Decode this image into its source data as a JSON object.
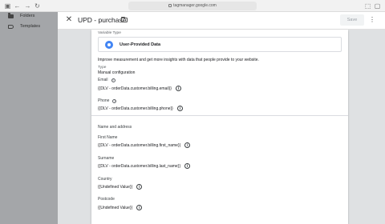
{
  "browser": {
    "url": "tagmanager.google.com"
  },
  "sidebar": {
    "items": [
      {
        "label": "Folders",
        "icon": "folder-icon"
      },
      {
        "label": "Templates",
        "icon": "tag-icon"
      }
    ]
  },
  "panel": {
    "title": "UPD - purchase",
    "save_label": "Save"
  },
  "variable": {
    "type_label": "Variable Type",
    "type_name": "User-Provided Data",
    "description": "Improve measurement and get more insights with data that people provide to your website.",
    "type_heading": "Type",
    "type_value": "Manual configuration",
    "fields": [
      {
        "label": "Email",
        "value": "{{DLV - orderData.customer.billing.email}}"
      },
      {
        "label": "Phone",
        "value": "{{DLV - orderData.customer.billing.phone}}"
      }
    ],
    "address_heading": "Name and address",
    "address_fields": [
      {
        "label": "First Name",
        "value": "{{DLV - orderData.customer.billing.first_name}}"
      },
      {
        "label": "Surname",
        "value": "{{DLV - orderData.customer.billing.last_name}}"
      },
      {
        "label": "Country",
        "value": "{{Undefined Value}}"
      },
      {
        "label": "Postcode",
        "value": "{{Undefined Value}}"
      }
    ]
  },
  "colors": {
    "sidebar_bg": "#a4a6a9",
    "panel_bg": "#dfe1e3",
    "accent_blue": "#4285f4"
  }
}
